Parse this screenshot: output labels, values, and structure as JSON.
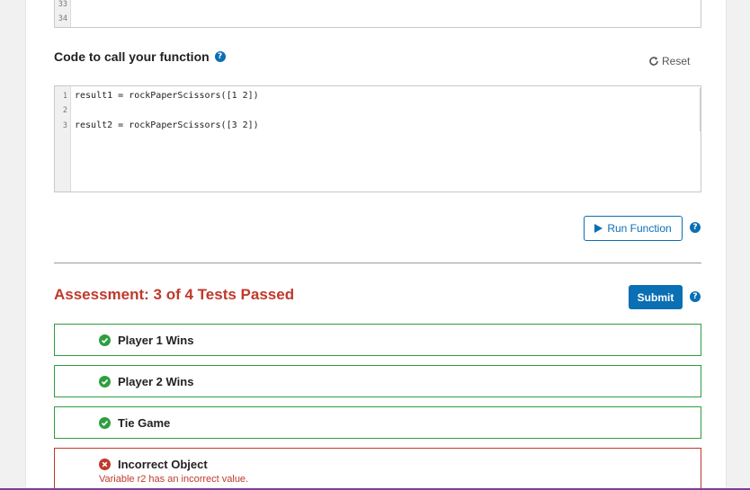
{
  "top_editor": {
    "line_numbers": [
      "33",
      "34"
    ]
  },
  "call_section": {
    "title": "Code to call your function",
    "help_icon": "question-circle-icon",
    "reset_label": "Reset",
    "reset_icon": "refresh-icon",
    "lines": [
      {
        "num": "1",
        "code": "result1 = rockPaperScissors([1 2])"
      },
      {
        "num": "2",
        "code": ""
      },
      {
        "num": "3",
        "code": "result2 = rockPaperScissors([3 2])"
      }
    ]
  },
  "run_button": {
    "label": "Run Function",
    "icon": "play-icon"
  },
  "assessment": {
    "title": "Assessment: 3 of 4 Tests Passed",
    "submit_label": "Submit",
    "tests": [
      {
        "label": "Player 1 Wins",
        "status": "pass"
      },
      {
        "label": "Player 2 Wins",
        "status": "pass"
      },
      {
        "label": "Tie Game",
        "status": "pass"
      },
      {
        "label": "Incorrect Object",
        "status": "fail",
        "message": "Variable r2 has an incorrect value."
      }
    ]
  },
  "colors": {
    "accent": "#0a6fb3",
    "pass": "#2e9e3e",
    "fail": "#c0392b"
  }
}
